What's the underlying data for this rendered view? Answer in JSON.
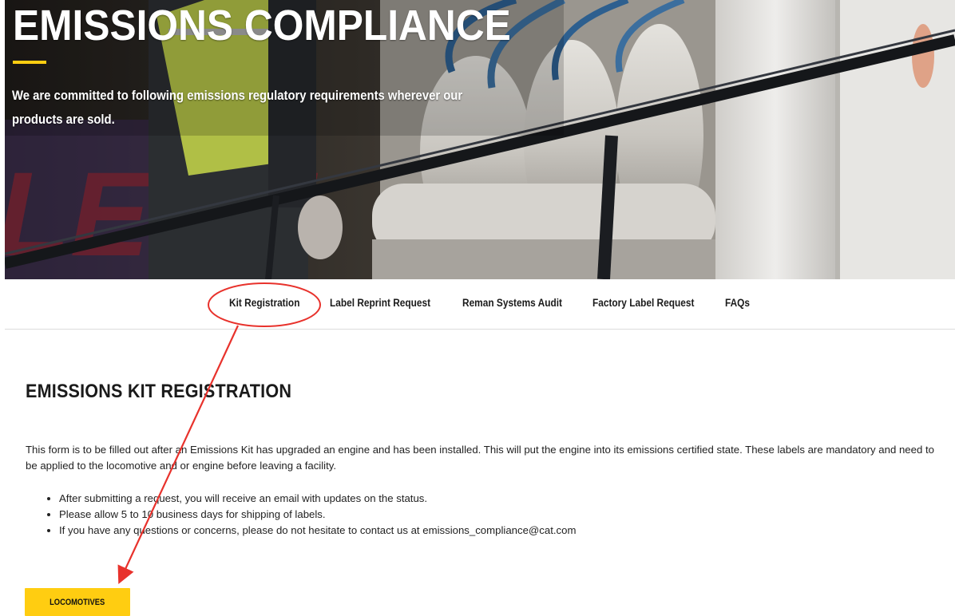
{
  "hero": {
    "title": "EMISSIONS COMPLIANCE",
    "subtitle": "We are committed to following emissions regulatory requirements wherever our products are sold.",
    "accent_color": "#ffcd11"
  },
  "nav": {
    "items": [
      {
        "label": "Kit Registration",
        "highlighted": true
      },
      {
        "label": "Label Reprint Request"
      },
      {
        "label": "Reman Systems Audit"
      },
      {
        "label": "Factory Label Request"
      },
      {
        "label": "FAQs"
      }
    ]
  },
  "content": {
    "title": "EMISSIONS KIT REGISTRATION",
    "description": "This form is to be filled out after an Emissions Kit has upgraded an engine and has been installed. This will put the engine into its emissions certified state. These labels are mandatory and need to be applied to the locomotive and or engine before leaving a facility.",
    "bullets": [
      "After submitting a request, you will receive an email with updates on the status.",
      "Please allow 5 to 10 business days for shipping of labels.",
      "If you have any questions or concerns, please do not hesitate to contact us at emissions_compliance@cat.com"
    ],
    "button_label": "LOCOMOTIVES"
  },
  "annotation": {
    "color": "#e8322c"
  }
}
